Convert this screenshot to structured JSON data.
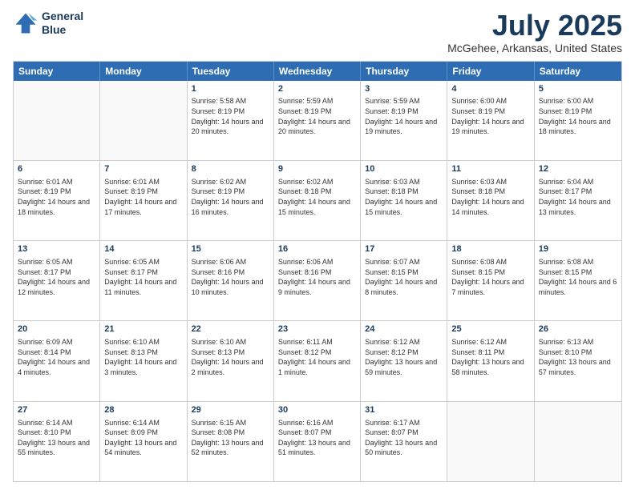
{
  "logo": {
    "line1": "General",
    "line2": "Blue"
  },
  "header": {
    "month": "July 2025",
    "location": "McGehee, Arkansas, United States"
  },
  "days_of_week": [
    "Sunday",
    "Monday",
    "Tuesday",
    "Wednesday",
    "Thursday",
    "Friday",
    "Saturday"
  ],
  "weeks": [
    [
      {
        "day": "",
        "sunrise": "",
        "sunset": "",
        "daylight": "",
        "empty": true
      },
      {
        "day": "",
        "sunrise": "",
        "sunset": "",
        "daylight": "",
        "empty": true
      },
      {
        "day": "1",
        "sunrise": "Sunrise: 5:58 AM",
        "sunset": "Sunset: 8:19 PM",
        "daylight": "Daylight: 14 hours and 20 minutes."
      },
      {
        "day": "2",
        "sunrise": "Sunrise: 5:59 AM",
        "sunset": "Sunset: 8:19 PM",
        "daylight": "Daylight: 14 hours and 20 minutes."
      },
      {
        "day": "3",
        "sunrise": "Sunrise: 5:59 AM",
        "sunset": "Sunset: 8:19 PM",
        "daylight": "Daylight: 14 hours and 19 minutes."
      },
      {
        "day": "4",
        "sunrise": "Sunrise: 6:00 AM",
        "sunset": "Sunset: 8:19 PM",
        "daylight": "Daylight: 14 hours and 19 minutes."
      },
      {
        "day": "5",
        "sunrise": "Sunrise: 6:00 AM",
        "sunset": "Sunset: 8:19 PM",
        "daylight": "Daylight: 14 hours and 18 minutes."
      }
    ],
    [
      {
        "day": "6",
        "sunrise": "Sunrise: 6:01 AM",
        "sunset": "Sunset: 8:19 PM",
        "daylight": "Daylight: 14 hours and 18 minutes."
      },
      {
        "day": "7",
        "sunrise": "Sunrise: 6:01 AM",
        "sunset": "Sunset: 8:19 PM",
        "daylight": "Daylight: 14 hours and 17 minutes."
      },
      {
        "day": "8",
        "sunrise": "Sunrise: 6:02 AM",
        "sunset": "Sunset: 8:19 PM",
        "daylight": "Daylight: 14 hours and 16 minutes."
      },
      {
        "day": "9",
        "sunrise": "Sunrise: 6:02 AM",
        "sunset": "Sunset: 8:18 PM",
        "daylight": "Daylight: 14 hours and 15 minutes."
      },
      {
        "day": "10",
        "sunrise": "Sunrise: 6:03 AM",
        "sunset": "Sunset: 8:18 PM",
        "daylight": "Daylight: 14 hours and 15 minutes."
      },
      {
        "day": "11",
        "sunrise": "Sunrise: 6:03 AM",
        "sunset": "Sunset: 8:18 PM",
        "daylight": "Daylight: 14 hours and 14 minutes."
      },
      {
        "day": "12",
        "sunrise": "Sunrise: 6:04 AM",
        "sunset": "Sunset: 8:17 PM",
        "daylight": "Daylight: 14 hours and 13 minutes."
      }
    ],
    [
      {
        "day": "13",
        "sunrise": "Sunrise: 6:05 AM",
        "sunset": "Sunset: 8:17 PM",
        "daylight": "Daylight: 14 hours and 12 minutes."
      },
      {
        "day": "14",
        "sunrise": "Sunrise: 6:05 AM",
        "sunset": "Sunset: 8:17 PM",
        "daylight": "Daylight: 14 hours and 11 minutes."
      },
      {
        "day": "15",
        "sunrise": "Sunrise: 6:06 AM",
        "sunset": "Sunset: 8:16 PM",
        "daylight": "Daylight: 14 hours and 10 minutes."
      },
      {
        "day": "16",
        "sunrise": "Sunrise: 6:06 AM",
        "sunset": "Sunset: 8:16 PM",
        "daylight": "Daylight: 14 hours and 9 minutes."
      },
      {
        "day": "17",
        "sunrise": "Sunrise: 6:07 AM",
        "sunset": "Sunset: 8:15 PM",
        "daylight": "Daylight: 14 hours and 8 minutes."
      },
      {
        "day": "18",
        "sunrise": "Sunrise: 6:08 AM",
        "sunset": "Sunset: 8:15 PM",
        "daylight": "Daylight: 14 hours and 7 minutes."
      },
      {
        "day": "19",
        "sunrise": "Sunrise: 6:08 AM",
        "sunset": "Sunset: 8:15 PM",
        "daylight": "Daylight: 14 hours and 6 minutes."
      }
    ],
    [
      {
        "day": "20",
        "sunrise": "Sunrise: 6:09 AM",
        "sunset": "Sunset: 8:14 PM",
        "daylight": "Daylight: 14 hours and 4 minutes."
      },
      {
        "day": "21",
        "sunrise": "Sunrise: 6:10 AM",
        "sunset": "Sunset: 8:13 PM",
        "daylight": "Daylight: 14 hours and 3 minutes."
      },
      {
        "day": "22",
        "sunrise": "Sunrise: 6:10 AM",
        "sunset": "Sunset: 8:13 PM",
        "daylight": "Daylight: 14 hours and 2 minutes."
      },
      {
        "day": "23",
        "sunrise": "Sunrise: 6:11 AM",
        "sunset": "Sunset: 8:12 PM",
        "daylight": "Daylight: 14 hours and 1 minute."
      },
      {
        "day": "24",
        "sunrise": "Sunrise: 6:12 AM",
        "sunset": "Sunset: 8:12 PM",
        "daylight": "Daylight: 13 hours and 59 minutes."
      },
      {
        "day": "25",
        "sunrise": "Sunrise: 6:12 AM",
        "sunset": "Sunset: 8:11 PM",
        "daylight": "Daylight: 13 hours and 58 minutes."
      },
      {
        "day": "26",
        "sunrise": "Sunrise: 6:13 AM",
        "sunset": "Sunset: 8:10 PM",
        "daylight": "Daylight: 13 hours and 57 minutes."
      }
    ],
    [
      {
        "day": "27",
        "sunrise": "Sunrise: 6:14 AM",
        "sunset": "Sunset: 8:10 PM",
        "daylight": "Daylight: 13 hours and 55 minutes."
      },
      {
        "day": "28",
        "sunrise": "Sunrise: 6:14 AM",
        "sunset": "Sunset: 8:09 PM",
        "daylight": "Daylight: 13 hours and 54 minutes."
      },
      {
        "day": "29",
        "sunrise": "Sunrise: 6:15 AM",
        "sunset": "Sunset: 8:08 PM",
        "daylight": "Daylight: 13 hours and 52 minutes."
      },
      {
        "day": "30",
        "sunrise": "Sunrise: 6:16 AM",
        "sunset": "Sunset: 8:07 PM",
        "daylight": "Daylight: 13 hours and 51 minutes."
      },
      {
        "day": "31",
        "sunrise": "Sunrise: 6:17 AM",
        "sunset": "Sunset: 8:07 PM",
        "daylight": "Daylight: 13 hours and 50 minutes."
      },
      {
        "day": "",
        "sunrise": "",
        "sunset": "",
        "daylight": "",
        "empty": true
      },
      {
        "day": "",
        "sunrise": "",
        "sunset": "",
        "daylight": "",
        "empty": true
      }
    ]
  ]
}
